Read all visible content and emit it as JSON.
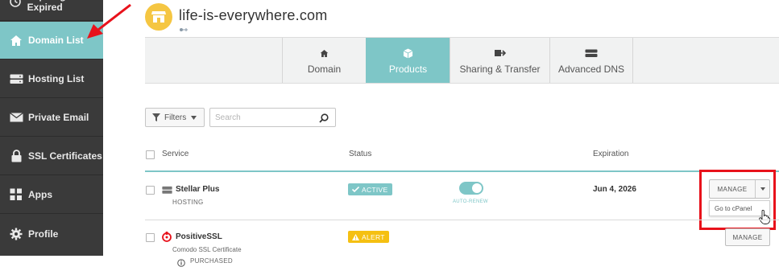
{
  "sidebar": {
    "items": [
      {
        "label": "Expiring / Expired",
        "icon": "clock-icon"
      },
      {
        "label": "Domain List",
        "icon": "home-icon"
      },
      {
        "label": "Hosting List",
        "icon": "server-icon"
      },
      {
        "label": "Private Email",
        "icon": "envelope-icon"
      },
      {
        "label": "SSL Certificates",
        "icon": "lock-icon"
      },
      {
        "label": "Apps",
        "icon": "apps-icon"
      },
      {
        "label": "Profile",
        "icon": "gear-icon"
      }
    ],
    "active_color": "#7ec6c7",
    "bg_color": "#3a3a3a"
  },
  "header": {
    "title": "life-is-everywhere.com",
    "logo_color": "#f5c642"
  },
  "tabs": [
    {
      "label": "Domain",
      "icon": "home-icon"
    },
    {
      "label": "Products",
      "icon": "box-icon"
    },
    {
      "label": "Sharing & Transfer",
      "icon": "transfer-icon"
    },
    {
      "label": "Advanced DNS",
      "icon": "dns-icon"
    }
  ],
  "toolbar": {
    "filters_label": "Filters",
    "search_placeholder": "Search"
  },
  "table": {
    "columns": [
      "Service",
      "Status",
      "Expiration"
    ],
    "rows": [
      {
        "service": "Stellar Plus",
        "subtitle": "HOSTING",
        "status": "ACTIVE",
        "status_color": "#7ec6c7",
        "autorenew_label": "AUTO-RENEW",
        "autorenew_on": true,
        "expiration": "Jun 4, 2026",
        "manage_label": "MANAGE",
        "dropdown_item": "Go to cPanel"
      },
      {
        "service": "PositiveSSL",
        "subtitle": "Comodo SSL Certificate",
        "note": "PURCHASED",
        "status": "ALERT",
        "status_color": "#f5c012",
        "manage_label": "MANAGE"
      }
    ]
  },
  "annotation_color": "#e8121b"
}
